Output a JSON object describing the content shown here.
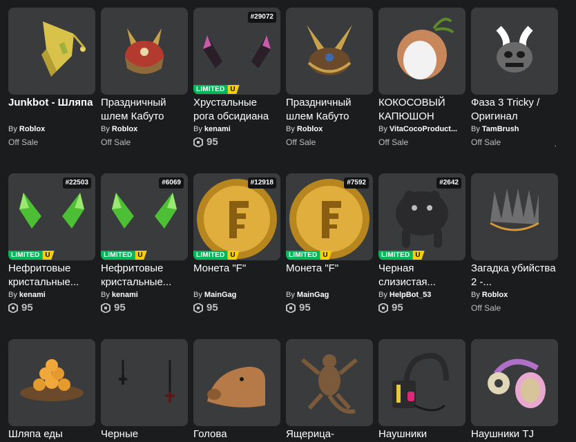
{
  "items": [
    {
      "name": "Junkbot - Шляпа",
      "creator_prefix": "By",
      "creator": "Roblox",
      "status": "Off Sale",
      "bold": true
    },
    {
      "name": "Праздничный шлем Кабуто",
      "creator_prefix": "By",
      "creator": "Roblox",
      "status": "Off Sale"
    },
    {
      "name": "Хрустальные рога обсидиана",
      "creator_prefix": "By",
      "creator": "kenami",
      "price": "95",
      "serial": "#29072",
      "limited": "LIMITED",
      "limited_u": "U"
    },
    {
      "name": "Праздничный шлем Кабуто",
      "creator_prefix": "By",
      "creator": "Roblox",
      "status": "Off Sale"
    },
    {
      "name": "КОКОСОВЫЙ КАПЮШОН",
      "creator_prefix": "By",
      "creator": "VitaCocoProduct...",
      "status": "Off Sale"
    },
    {
      "name": "Фаза 3 Tricky / Оригинал",
      "creator_prefix": "By",
      "creator": "TamBrush",
      "status": "Off Sale",
      "more": "·"
    },
    {
      "name": "Нефритовые кристальные...",
      "creator_prefix": "By",
      "creator": "kenami",
      "price": "95",
      "serial": "#22503",
      "limited": "LIMITED",
      "limited_u": "U"
    },
    {
      "name": "Нефритовые кристальные...",
      "creator_prefix": "By",
      "creator": "kenami",
      "price": "95",
      "serial": "#6069",
      "limited": "LIMITED",
      "limited_u": "U"
    },
    {
      "name": "Монета \"F\"",
      "creator_prefix": "By",
      "creator": "MainGag",
      "price": "95",
      "serial": "#12918",
      "limited": "LIMITED",
      "limited_u": "U"
    },
    {
      "name": "Монета \"F\"",
      "creator_prefix": "By",
      "creator": "MainGag",
      "price": "95",
      "serial": "#7592",
      "limited": "LIMITED",
      "limited_u": "U"
    },
    {
      "name": "Черная слизистая...",
      "creator_prefix": "By",
      "creator": "HelpBot_53",
      "price": "95",
      "serial": "#2642",
      "limited": "LIMITED",
      "limited_u": "U"
    },
    {
      "name": "Загадка убийства 2 -...",
      "creator_prefix": "By",
      "creator": "Roblox",
      "status": "Off Sale"
    },
    {
      "name": "Шляпа еды"
    },
    {
      "name": "Черные"
    },
    {
      "name": "Голова"
    },
    {
      "name": "Ящерица-"
    },
    {
      "name": "Наушники"
    },
    {
      "name": "Наушники TJ"
    }
  ],
  "colors": {
    "background": "#1b1c1e",
    "card": "#393b3d",
    "limited": "#02b757",
    "unique": "#f5cc0f"
  },
  "icons": {
    "currency": "robux-icon"
  }
}
